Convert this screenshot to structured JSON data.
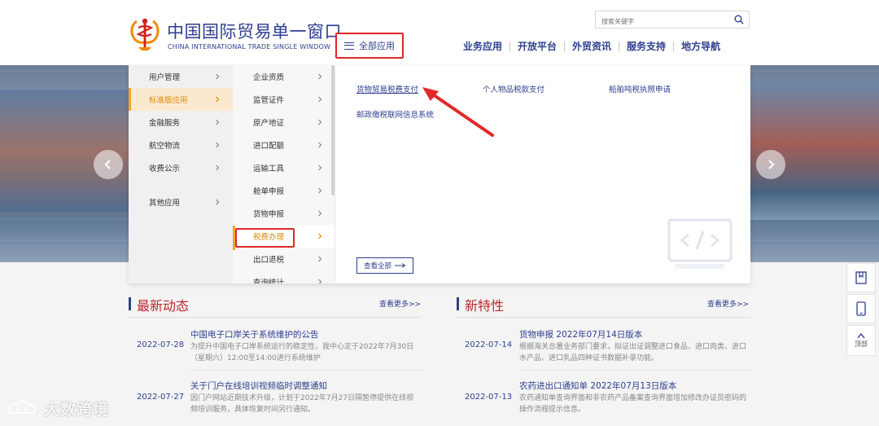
{
  "header": {
    "logo_cn": "中国国际贸易单一窗口",
    "logo_en": "CHINA INTERNATIONAL TRADE SINGLE WINDOW",
    "all_apps": "全部应用",
    "search_placeholder": "搜索关键字",
    "nav": [
      "业务应用",
      "开放平台",
      "外贸资讯",
      "服务支持",
      "地方导航"
    ]
  },
  "menu": {
    "primary": [
      "用户管理",
      "标准版应用",
      "金融服务",
      "航空物流",
      "收费公示",
      "其他应用"
    ],
    "secondary": [
      "企业资质",
      "监管证件",
      "原产地证",
      "进口配额",
      "运输工具",
      "舱单申报",
      "货物申报",
      "税费办理",
      "出口退税",
      "查询统计"
    ],
    "tertiary": [
      "货物贸易税费支付",
      "个人物品税款支付",
      "船舶吨税执照申请",
      "邮政缴税联网信息系统"
    ],
    "view_all": "查看全部"
  },
  "news": {
    "latest": {
      "title": "最新动态",
      "more": "查看更多>>",
      "items": [
        {
          "date": "2022-07-28",
          "title": "中国电子口岸关于系统维护的公告",
          "desc": "为提升中国电子口岸系统运行的稳定性，我中心定于2022年7月30日（星期六）12:00至14:00进行系统维护"
        },
        {
          "date": "2022-07-27",
          "title": "关于门户在线培训视频临时调整通知",
          "desc": "因门户网站近期技术升级，计划于2022年7月27日隔暂停提供在线视频培训服务，具体恢复时间另行通知。"
        }
      ]
    },
    "features": {
      "title": "新特性",
      "more": "查看更多>>",
      "items": [
        {
          "date": "2022-07-14",
          "title": "货物申报 2022年07月14日版本",
          "desc": "根据海关总署业务部门要求，拟证出证调整进口食品、进口肉类、进口水产品、进口乳品四种证书数据补录功能。"
        },
        {
          "date": "2022-07-13",
          "title": "农药进出口通知单 2022年07月13日版本",
          "desc": "农药通知单查询界面和非农药产品备案查询界面增加修改办证员密码的操作流程提示信息。"
        }
      ]
    }
  },
  "side_tools": {
    "top_label": "顶部"
  },
  "watermark": "大数跨境",
  "colors": {
    "brand_blue": "#2d3e8f",
    "accent_orange": "#f5a623",
    "highlight_red": "#e02828",
    "title_red": "#c0262d"
  }
}
